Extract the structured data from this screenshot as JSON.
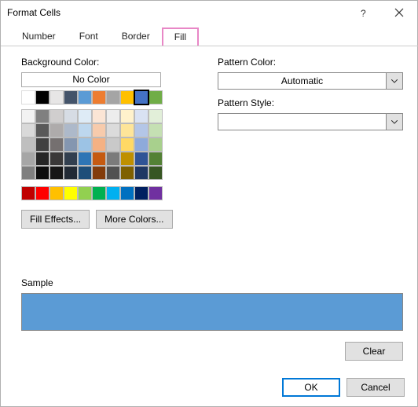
{
  "title": "Format Cells",
  "tabs": {
    "number": "Number",
    "font": "Font",
    "border": "Border",
    "fill": "Fill"
  },
  "labels": {
    "bg_color": "Background Color:",
    "no_color": "No Color",
    "pattern_color": "Pattern Color:",
    "pattern_style": "Pattern Style:",
    "automatic": "Automatic",
    "sample": "Sample",
    "fill_effects": "Fill Effects...",
    "more_colors": "More Colors...",
    "clear": "Clear",
    "ok": "OK",
    "cancel": "Cancel"
  },
  "selected_color": "#5b9bd5",
  "theme_row1": [
    "#ffffff",
    "#000000",
    "#e7e6e6",
    "#44546a",
    "#5b9bd5",
    "#ed7d31",
    "#a5a5a5",
    "#ffc000",
    "#4472c4",
    "#70ad47"
  ],
  "theme_rows": [
    [
      "#f2f2f2",
      "#808080",
      "#d0cece",
      "#d6dce4",
      "#deebf6",
      "#fbe5d5",
      "#ededed",
      "#fff2cc",
      "#d9e2f3",
      "#e2efd9"
    ],
    [
      "#d9d9d9",
      "#595959",
      "#aeabab",
      "#adb9ca",
      "#bdd7ee",
      "#f7cbac",
      "#dbdbdb",
      "#fee599",
      "#b4c6e7",
      "#c5e0b3"
    ],
    [
      "#bfbfbf",
      "#404040",
      "#757070",
      "#8496b0",
      "#9cc3e5",
      "#f4b183",
      "#c9c9c9",
      "#ffd965",
      "#8eaadb",
      "#a8d08d"
    ],
    [
      "#a6a6a6",
      "#262626",
      "#3a3838",
      "#323f4f",
      "#2e75b5",
      "#c55a11",
      "#7b7b7b",
      "#bf9000",
      "#2f5496",
      "#538135"
    ],
    [
      "#7f7f7f",
      "#0d0d0d",
      "#171616",
      "#222a35",
      "#1e4e79",
      "#833c0b",
      "#525252",
      "#7f6000",
      "#1f3864",
      "#375623"
    ]
  ],
  "standard_colors": [
    "#c00000",
    "#ff0000",
    "#ffc000",
    "#ffff00",
    "#92d050",
    "#00b050",
    "#00b0f0",
    "#0070c0",
    "#002060",
    "#7030a0"
  ]
}
